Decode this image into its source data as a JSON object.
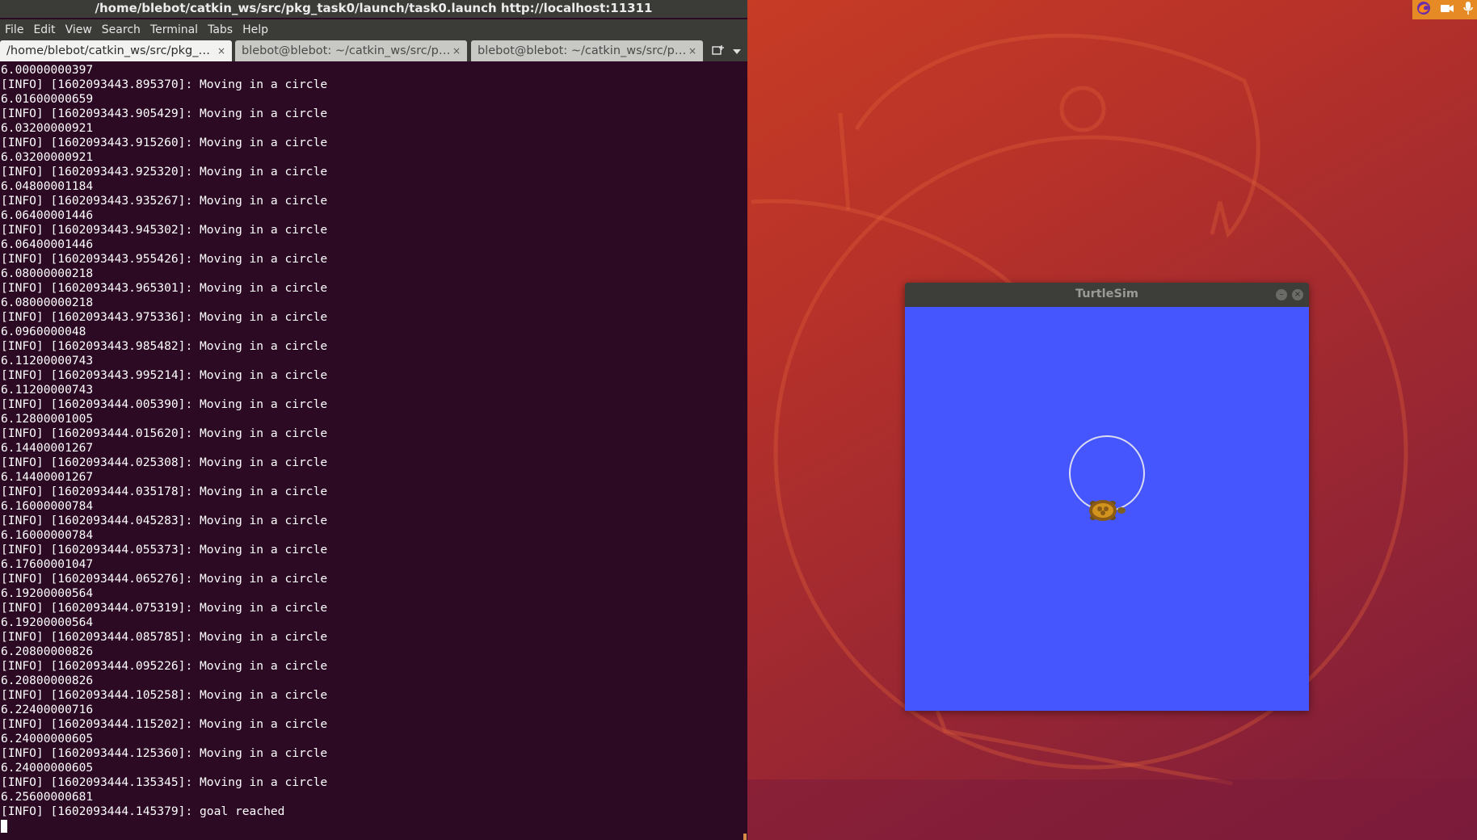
{
  "terminal": {
    "window_title": "/home/blebot/catkin_ws/src/pkg_task0/launch/task0.launch http://localhost:11311",
    "menu": [
      "File",
      "Edit",
      "View",
      "Search",
      "Terminal",
      "Tabs",
      "Help"
    ],
    "tabs": [
      {
        "label": "/home/blebot/catkin_ws/src/pkg_…",
        "close": "×",
        "active": true
      },
      {
        "label": "blebot@blebot: ~/catkin_ws/src/p…",
        "close": "×",
        "active": false
      },
      {
        "label": "blebot@blebot: ~/catkin_ws/src/p…",
        "close": "×",
        "active": false
      }
    ],
    "output": [
      "6.00000000397",
      "[INFO] [1602093443.895370]: Moving in a circle",
      "6.01600000659",
      "[INFO] [1602093443.905429]: Moving in a circle",
      "6.03200000921",
      "[INFO] [1602093443.915260]: Moving in a circle",
      "6.03200000921",
      "[INFO] [1602093443.925320]: Moving in a circle",
      "6.04800001184",
      "[INFO] [1602093443.935267]: Moving in a circle",
      "6.06400001446",
      "[INFO] [1602093443.945302]: Moving in a circle",
      "6.06400001446",
      "[INFO] [1602093443.955426]: Moving in a circle",
      "6.08000000218",
      "[INFO] [1602093443.965301]: Moving in a circle",
      "6.08000000218",
      "[INFO] [1602093443.975336]: Moving in a circle",
      "6.0960000048",
      "[INFO] [1602093443.985482]: Moving in a circle",
      "6.11200000743",
      "[INFO] [1602093443.995214]: Moving in a circle",
      "6.11200000743",
      "[INFO] [1602093444.005390]: Moving in a circle",
      "6.12800001005",
      "[INFO] [1602093444.015620]: Moving in a circle",
      "6.14400001267",
      "[INFO] [1602093444.025308]: Moving in a circle",
      "6.14400001267",
      "[INFO] [1602093444.035178]: Moving in a circle",
      "6.16000000784",
      "[INFO] [1602093444.045283]: Moving in a circle",
      "6.16000000784",
      "[INFO] [1602093444.055373]: Moving in a circle",
      "6.17600001047",
      "[INFO] [1602093444.065276]: Moving in a circle",
      "6.19200000564",
      "[INFO] [1602093444.075319]: Moving in a circle",
      "6.19200000564",
      "[INFO] [1602093444.085785]: Moving in a circle",
      "6.20800000826",
      "[INFO] [1602093444.095226]: Moving in a circle",
      "6.20800000826",
      "[INFO] [1602093444.105258]: Moving in a circle",
      "6.22400000716",
      "[INFO] [1602093444.115202]: Moving in a circle",
      "6.24000000605",
      "[INFO] [1602093444.125360]: Moving in a circle",
      "6.24000000605",
      "[INFO] [1602093444.135345]: Moving in a circle",
      "6.25600000681",
      "[INFO] [1602093444.145379]: goal reached"
    ]
  },
  "tray_icons": [
    "firefox-icon",
    "camera-icon",
    "microphone-icon"
  ],
  "turtlesim": {
    "window_title": "TurtleSim",
    "background_color": "#4556ff",
    "path_color": "#dcdcf0"
  },
  "wallpaper": {
    "accent": "#c9402a"
  }
}
